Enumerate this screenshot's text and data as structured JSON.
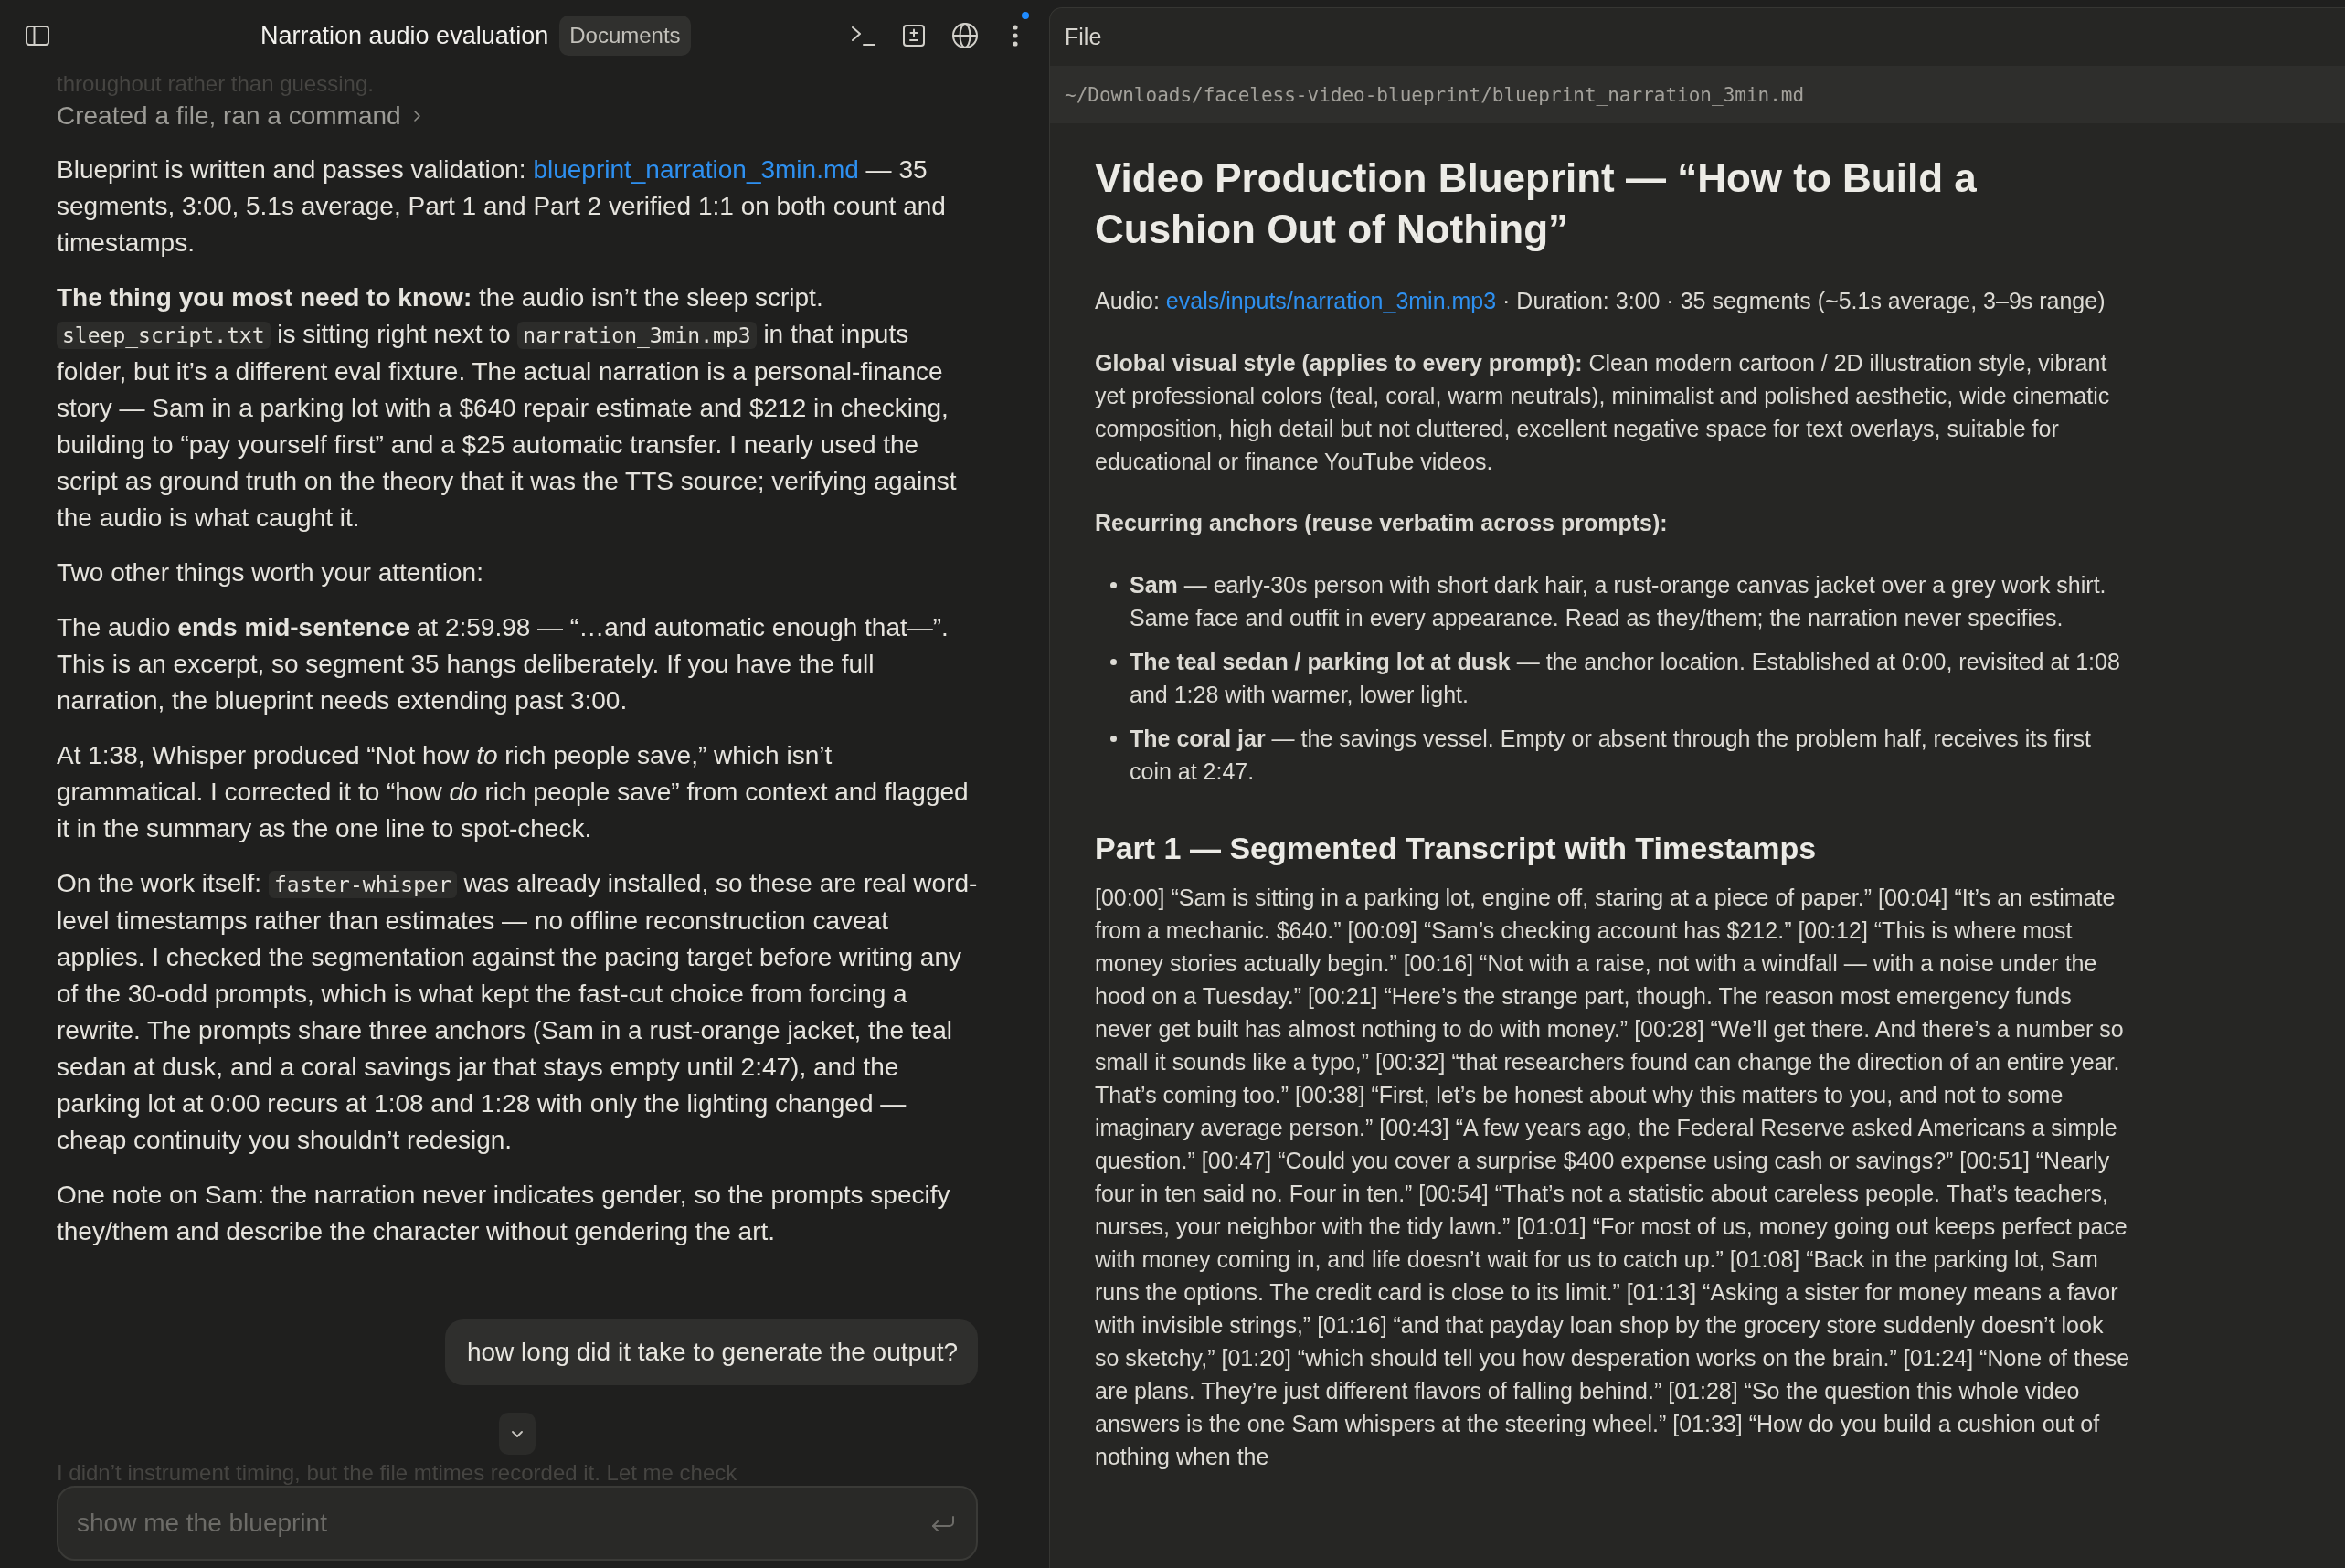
{
  "header": {
    "title": "Narration audio evaluation",
    "badge": "Documents",
    "menu_indicator": true
  },
  "chat": {
    "faded_top": "throughout rather than guessing.",
    "activity": "Created a file, ran a command",
    "paragraphs": [
      [
        {
          "kind": "text",
          "text": "Blueprint is written and passes validation: "
        },
        {
          "kind": "link",
          "text": "blueprint_narration_3min.md"
        },
        {
          "kind": "text",
          "text": " — 35 segments, 3:00, 5.1s average, Part 1 and Part 2 verified 1:1 on both count and timestamps."
        }
      ],
      [
        {
          "kind": "text",
          "text": "**The thing you most need to know:** the audio isn’t the sleep script. "
        },
        {
          "kind": "code",
          "text": "sleep_script.txt"
        },
        {
          "kind": "text",
          "text": " is sitting right next to "
        },
        {
          "kind": "code",
          "text": "narration_3min.mp3"
        },
        {
          "kind": "text",
          "text": " in that inputs folder, but it’s a different eval fixture. The actual narration is a personal-finance story — Sam in a parking lot with a $640 repair estimate and $212 in checking, building to “pay yourself first” and a $25 automatic transfer. I nearly used the script as ground truth on the theory that it was the TTS source; verifying against the audio is what caught it."
        }
      ],
      [
        {
          "kind": "text",
          "text": "Two other things worth your attention:"
        }
      ],
      [
        {
          "kind": "text",
          "text": "The audio **ends mid-sentence** at 2:59.98 — “…and automatic enough that—”. This is an excerpt, so segment 35 hangs deliberately. If you have the full narration, the blueprint needs extending past 3:00."
        }
      ],
      [
        {
          "kind": "text",
          "text": "At 1:38, Whisper produced “Not how *to* rich people save,” which isn’t grammatical. I corrected it to “how *do* rich people save” from context and flagged it in the summary as the one line to spot-check."
        }
      ],
      [
        {
          "kind": "text",
          "text": "On the work itself: "
        },
        {
          "kind": "code",
          "text": "faster-whisper"
        },
        {
          "kind": "text",
          "text": " was already installed, so these are real word-level timestamps rather than estimates — no offline reconstruction caveat applies. I checked the segmentation against the pacing target before writing any of the 30-odd prompts, which is what kept the fast-cut choice from forcing a rewrite. The prompts share three anchors (Sam in a rust-orange jacket, the teal sedan at dusk, and a coral savings jar that stays empty until 2:47), and the parking lot at 0:00 recurs at 1:08 and 1:28 with only the lighting changed — cheap continuity you shouldn’t redesign."
        }
      ],
      [
        {
          "kind": "text",
          "text": "One note on Sam: the narration never indicates gender, so the prompts specify they/them and describe the character without gendering the art."
        }
      ]
    ],
    "user_message": "how long did it take to generate the output?",
    "faded_bottom": "I didn’t instrument timing, but the file mtimes recorded it. Let me check"
  },
  "composer": {
    "placeholder": "show me the blueprint"
  },
  "file_panel": {
    "title": "File",
    "path": "~/Downloads/faceless-video-blueprint/blueprint_narration_3min.md",
    "heading": "Video Production Blueprint — “How to Build a Cushion Out of Nothing”",
    "audio_line": [
      {
        "kind": "text",
        "text": "Audio: "
      },
      {
        "kind": "link",
        "text": "evals/inputs/narration_3min.mp3"
      },
      {
        "kind": "text",
        "text": " · Duration: 3:00 · 35 segments (~5.1s average, 3–9s range)"
      }
    ],
    "style_paragraph": "**Global visual style (applies to every prompt):** Clean modern cartoon / 2D illustration style, vibrant yet professional colors (teal, coral, warm neutrals), minimalist and polished aesthetic, wide cinematic composition, high detail but not cluttered, excellent negative space for text overlays, suitable for educational or finance YouTube videos.",
    "anchors_heading": "Recurring anchors (reuse verbatim across prompts):",
    "anchors": [
      "**Sam** — early-30s person with short dark hair, a rust-orange canvas jacket over a grey work shirt. Same face and outfit in every appearance. Read as they/them; the narration never specifies.",
      "**The teal sedan / parking lot at dusk** — the anchor location. Established at 0:00, revisited at 1:08 and 1:28 with warmer, lower light.",
      "**The coral jar** — the savings vessel. Empty or absent through the problem half, receives its first coin at 2:47."
    ],
    "section_heading": "Part 1 — Segmented Transcript with Timestamps",
    "transcript": "[00:00] “Sam is sitting in a parking lot, engine off, staring at a piece of paper.” [00:04] “It’s an estimate from a mechanic. $640.” [00:09] “Sam’s checking account has $212.” [00:12] “This is where most money stories actually begin.” [00:16] “Not with a raise, not with a windfall — with a noise under the hood on a Tuesday.” [00:21] “Here’s the strange part, though. The reason most emergency funds never get built has almost nothing to do with money.” [00:28] “We’ll get there. And there’s a number so small it sounds like a typo,” [00:32] “that researchers found can change the direction of an entire year. That’s coming too.” [00:38] “First, let’s be honest about why this matters to you, and not to some imaginary average person.” [00:43] “A few years ago, the Federal Reserve asked Americans a simple question.” [00:47] “Could you cover a surprise $400 expense using cash or savings?” [00:51] “Nearly four in ten said no. Four in ten.” [00:54] “That’s not a statistic about careless people. That’s teachers, nurses, your neighbor with the tidy lawn.” [01:01] “For most of us, money going out keeps perfect pace with money coming in, and life doesn’t wait for us to catch up.” [01:08] “Back in the parking lot, Sam runs the options. The credit card is close to its limit.” [01:13] “Asking a sister for money means a favor with invisible strings,” [01:16] “and that payday loan shop by the grocery store suddenly doesn’t look so sketchy,” [01:20] “which should tell you how desperation works on the brain.” [01:24] “None of these are plans. They’re just different flavors of falling behind.” [01:28] “So the question this whole video answers is the one Sam whispers at the steering wheel.” [01:33] “How do you build a cushion out of nothing when the"
  }
}
